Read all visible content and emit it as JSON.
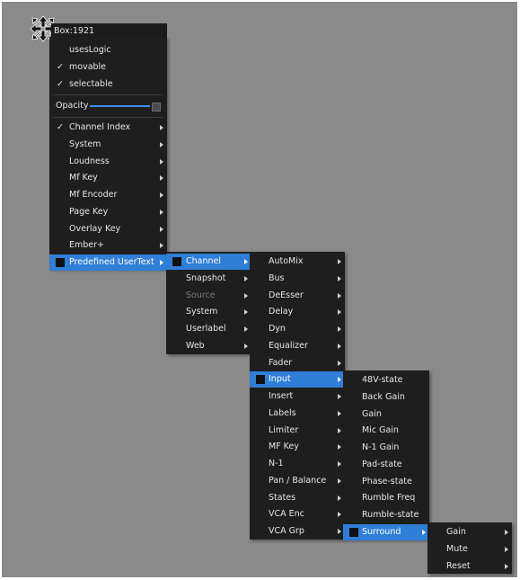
{
  "window": {
    "title": "Box:1921",
    "move_icon": "move-arrows-icon"
  },
  "main_menu": {
    "toggles": [
      {
        "label": "usesLogic",
        "checked": false
      },
      {
        "label": "movable",
        "checked": true
      },
      {
        "label": "selectable",
        "checked": true
      }
    ],
    "check_mark": "✓",
    "opacity": {
      "label": "Opacity",
      "value_percent": 100
    },
    "items": [
      {
        "label": "Channel Index",
        "checked": true
      },
      {
        "label": "System"
      },
      {
        "label": "Loudness"
      },
      {
        "label": "Mf Key"
      },
      {
        "label": "Mf Encoder"
      },
      {
        "label": "Page Key"
      },
      {
        "label": "Overlay Key"
      },
      {
        "label": "Ember+"
      },
      {
        "label": "Predefined UserText",
        "active": true
      }
    ]
  },
  "submenu_1": [
    {
      "label": "Channel",
      "active": true
    },
    {
      "label": "Snapshot"
    },
    {
      "label": "Source",
      "disabled": true
    },
    {
      "label": "System"
    },
    {
      "label": "Userlabel"
    },
    {
      "label": "Web"
    }
  ],
  "submenu_2": [
    {
      "label": "AutoMix"
    },
    {
      "label": "Bus"
    },
    {
      "label": "DeEsser"
    },
    {
      "label": "Delay"
    },
    {
      "label": "Dyn"
    },
    {
      "label": "Equalizer"
    },
    {
      "label": "Fader"
    },
    {
      "label": "Input",
      "active": true
    },
    {
      "label": "Insert"
    },
    {
      "label": "Labels"
    },
    {
      "label": "Limiter"
    },
    {
      "label": "MF Key"
    },
    {
      "label": "N-1"
    },
    {
      "label": "Pan / Balance"
    },
    {
      "label": "States"
    },
    {
      "label": "VCA Enc"
    },
    {
      "label": "VCA Grp"
    }
  ],
  "submenu_3": [
    {
      "label": "48V-state"
    },
    {
      "label": "Back Gain"
    },
    {
      "label": "Gain"
    },
    {
      "label": "Mic Gain"
    },
    {
      "label": "N-1 Gain"
    },
    {
      "label": "Pad-state"
    },
    {
      "label": "Phase-state"
    },
    {
      "label": "Rumble Freq"
    },
    {
      "label": "Rumble-state"
    },
    {
      "label": "Surround",
      "active": true
    }
  ],
  "submenu_4": [
    {
      "label": "Gain"
    },
    {
      "label": "Mute"
    },
    {
      "label": "Reset"
    }
  ],
  "colors": {
    "canvas": "#8a8a8a",
    "menu_bg": "#1e1e1e",
    "highlight": "#2f7ed8"
  }
}
